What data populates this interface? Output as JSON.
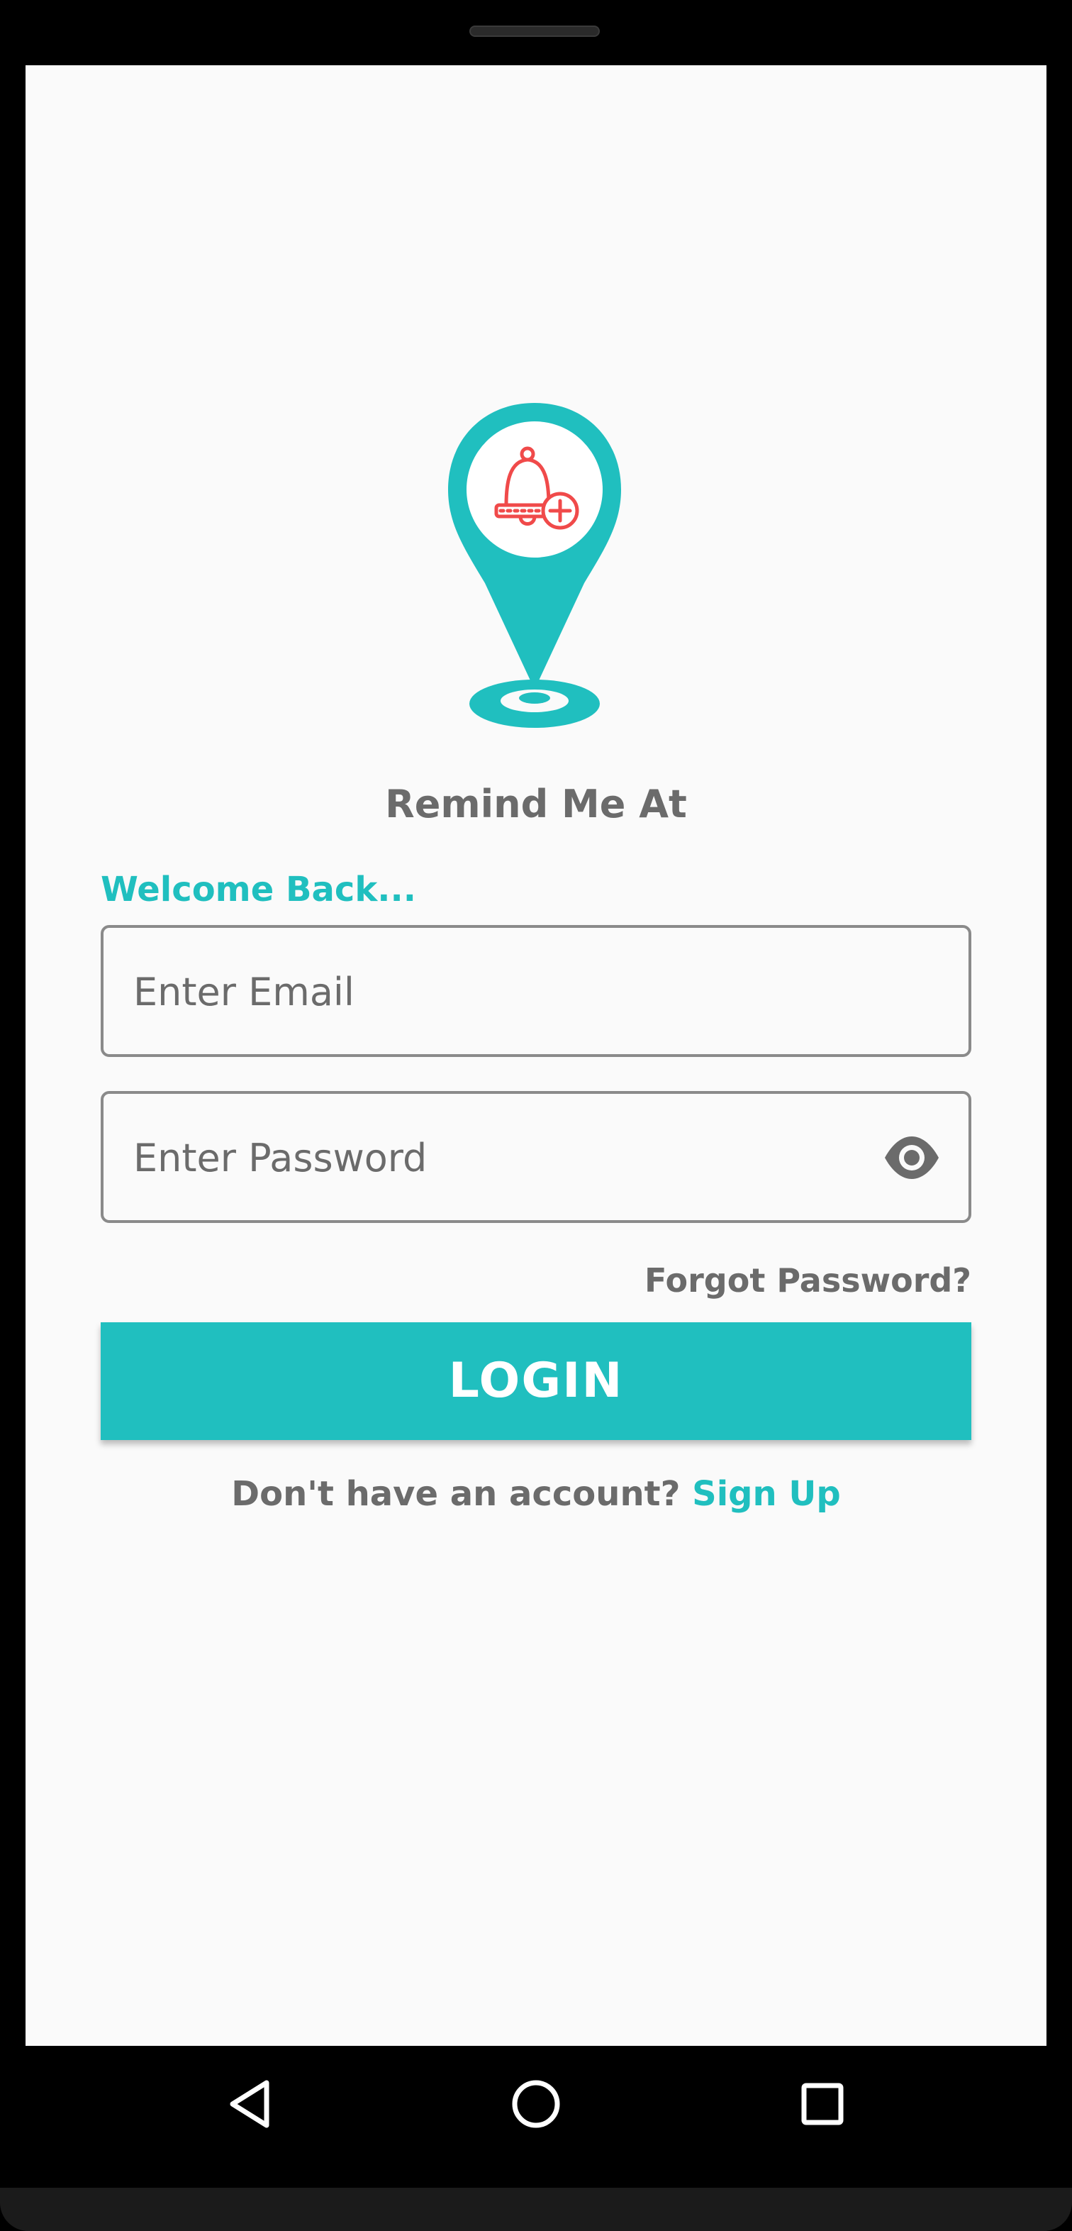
{
  "app": {
    "name": "Remind Me At",
    "welcome": "Welcome Back..."
  },
  "form": {
    "email_placeholder": "Enter Email",
    "email_value": "",
    "password_placeholder": "Enter Password",
    "password_value": "",
    "forgot_label": "Forgot Password?",
    "login_label": "LOGIN"
  },
  "signup": {
    "prompt": "Don't have an account?",
    "link_label": "Sign Up"
  },
  "icons": {
    "logo": "location-pin-bell-icon",
    "password_toggle": "eye-icon",
    "nav_back": "back-triangle-icon",
    "nav_home": "home-circle-icon",
    "nav_recent": "recent-square-icon"
  },
  "colors": {
    "accent": "#20bfbf",
    "text_muted": "#6b6b6b",
    "background": "#fafafa",
    "bell": "#f04a4a"
  }
}
